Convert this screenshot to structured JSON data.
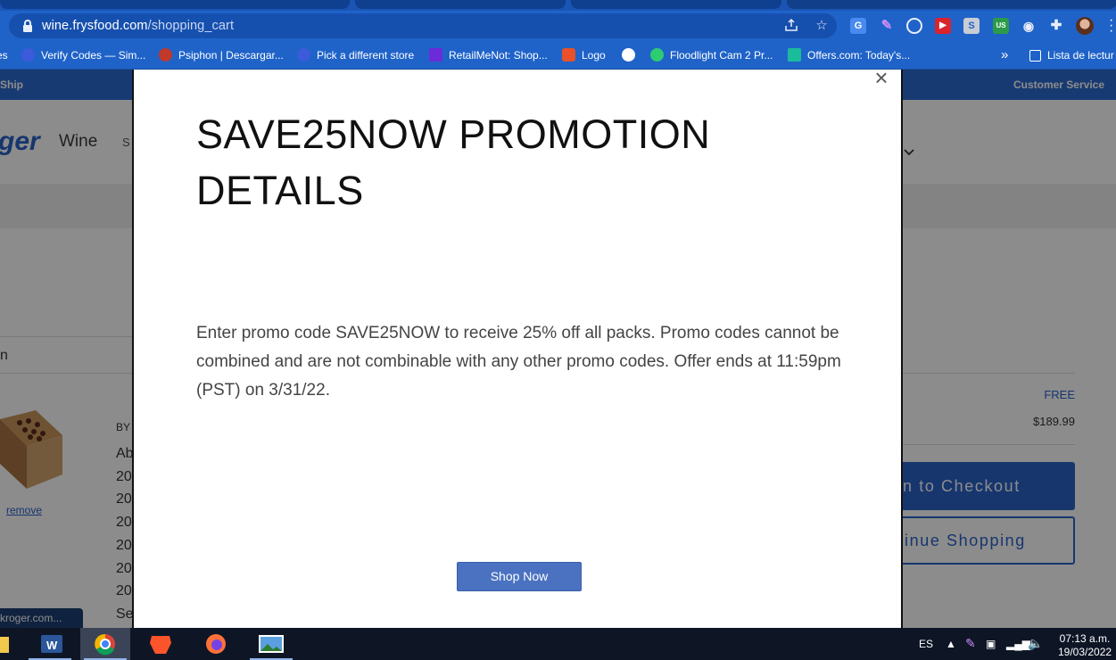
{
  "browser": {
    "url_host": "wine.frysfood.com",
    "url_path": "/shopping_cart",
    "bookmarks": [
      {
        "label": "es",
        "color": "#1f63c9"
      },
      {
        "label": "Verify Codes — Sim...",
        "color": "#3b5bdb"
      },
      {
        "label": "Psiphon | Descargar...",
        "color": "#c0392b"
      },
      {
        "label": "Pick a different store",
        "color": "#3b5bdb"
      },
      {
        "label": "RetailMeNot: Shop...",
        "color": "#6c2bd9"
      },
      {
        "label": "Logo",
        "color": "#e8512a"
      },
      {
        "label": "",
        "color": "#ffffff"
      },
      {
        "label": "Floodlight Cam 2 Pr...",
        "color": "#2ecc71"
      },
      {
        "label": "Offers.com: Today's...",
        "color": "#1abc9c"
      }
    ],
    "more_bookmarks": "»",
    "reading_list": "Lista de lectur"
  },
  "page_behind": {
    "ship_text": "Ship",
    "customer_service": "Customer Service",
    "brand_fragment": "ger",
    "wine_link": "Wine",
    "s_fragment": "S",
    "left_fragment": "n",
    "by_label": "BY",
    "item_lines": [
      "Ab",
      "20",
      "20",
      "20",
      "20",
      "20",
      "20",
      "Se"
    ],
    "remove_link": "remove",
    "shipping_value": "FREE",
    "subtotal_value": "$189.99",
    "checkout_button": "n to Checkout",
    "continue_button": "inue Shopping",
    "status_url": "kroger.com..."
  },
  "modal": {
    "title": "SAVE25NOW PROMOTION DETAILS",
    "body": "Enter promo code SAVE25NOW  to receive 25% off all packs. Promo codes cannot be combined and are not combinable with any other promo codes.  Offer ends at 11:59pm (PST) on 3/31/22.",
    "close_symbol": "×",
    "shop_now_button": "Shop Now"
  },
  "taskbar": {
    "language": "ES",
    "time": "07:13 a.m.",
    "date": "19/03/2022"
  }
}
